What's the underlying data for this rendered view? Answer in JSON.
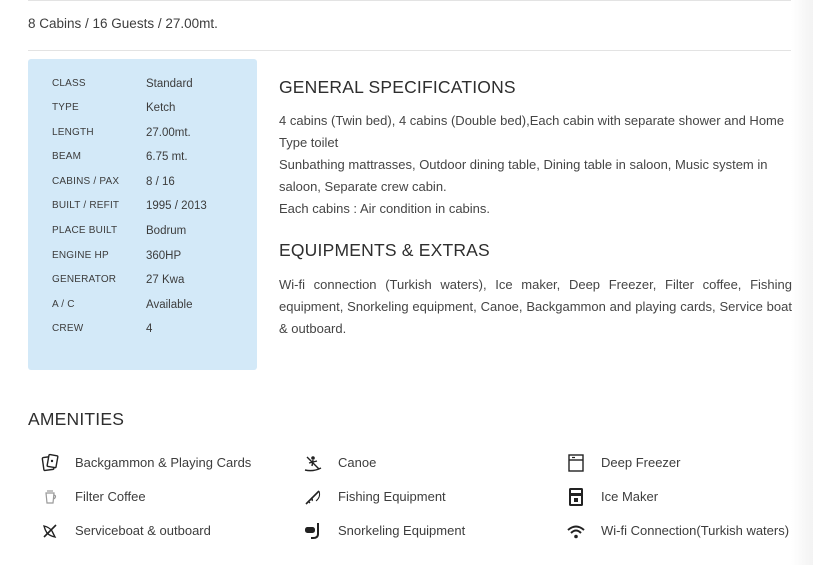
{
  "summary": "8 Cabins / 16 Guests / 27.00mt.",
  "specs": [
    {
      "label": "CLASS",
      "value": "Standard"
    },
    {
      "label": "TYPE",
      "value": "Ketch"
    },
    {
      "label": "LENGTH",
      "value": "27.00mt."
    },
    {
      "label": "BEAM",
      "value": "6.75 mt."
    },
    {
      "label": "CABINS / PAX",
      "value": "8 / 16"
    },
    {
      "label": "BUILT / REFIT",
      "value": "1995 / 2013"
    },
    {
      "label": "PLACE BUILT",
      "value": "Bodrum"
    },
    {
      "label": "ENGINE HP",
      "value": "360HP"
    },
    {
      "label": "GENERATOR",
      "value": "27 Kwa"
    },
    {
      "label": "A / C",
      "value": "Available"
    },
    {
      "label": "CREW",
      "value": "4"
    }
  ],
  "general": {
    "title": "GENERAL SPECIFICATIONS",
    "lines": [
      "4 cabins (Twin bed), 4 cabins (Double bed),Each cabin with separate shower and Home Type toilet",
      "Sunbathing mattrasses, Outdoor dining table, Dining table in saloon, Music system in saloon, Separate crew cabin.",
      "Each cabins : Air condition in cabins."
    ]
  },
  "equipment": {
    "title": "EQUIPMENTS & EXTRAS",
    "text": "Wi-fi connection (Turkish waters), Ice maker, Deep Freezer, Filter coffee, Fishing equipment, Snorkeling equipment, Canoe, Backgammon and playing cards, Service boat & outboard."
  },
  "amenities": {
    "title": "AMENITIES",
    "items": [
      {
        "label": "Backgammon & Playing Cards",
        "icon": "cards-icon"
      },
      {
        "label": "Canoe",
        "icon": "canoe-icon"
      },
      {
        "label": "Deep Freezer",
        "icon": "freezer-icon"
      },
      {
        "label": "Filter Coffee",
        "icon": "coffee-icon"
      },
      {
        "label": "Fishing Equipment",
        "icon": "fishing-icon"
      },
      {
        "label": "Ice Maker",
        "icon": "ice-maker-icon"
      },
      {
        "label": "Serviceboat & outboard",
        "icon": "boat-icon"
      },
      {
        "label": "Snorkeling Equipment",
        "icon": "snorkel-icon"
      },
      {
        "label": "Wi-fi Connection(Turkish waters)",
        "icon": "wifi-icon"
      }
    ]
  }
}
